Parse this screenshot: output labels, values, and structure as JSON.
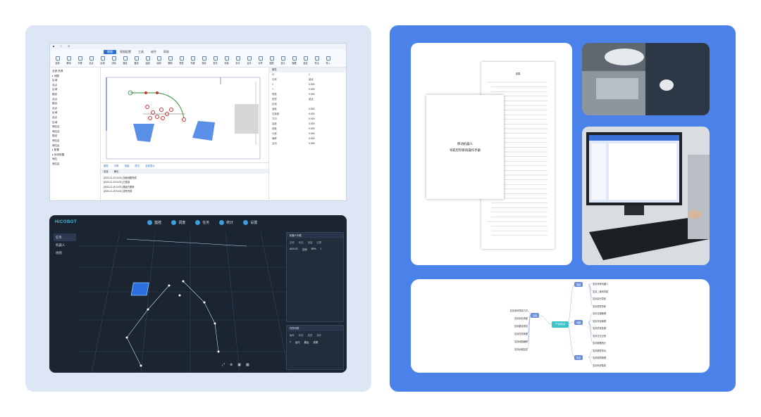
{
  "editor": {
    "menu": [
      "视图",
      "视图配置",
      "工具",
      "软件",
      "帮助"
    ],
    "ribbon": [
      "选择",
      "移动",
      "平移",
      "站点",
      "区域",
      "清除",
      "路径",
      "直线",
      "曲线",
      "绘制",
      "删除",
      "属性",
      "布置",
      "保存",
      "发布",
      "测量",
      "拆分",
      "合并",
      "对齐",
      "图层",
      "显示",
      "隐藏",
      "锁定",
      "导出",
      "导入"
    ],
    "tree": [
      "全部 资源",
      "▸ 地图",
      "区域",
      "站点",
      "区域",
      "路径",
      "站点",
      "路径",
      "站点",
      "区域",
      "站点",
      "区域",
      "储位区",
      "储位区",
      "路径",
      "储位区",
      "储位区",
      "▸ 配置",
      "▸ 系统配置",
      "储位",
      "储位区"
    ],
    "map_toolbar": [
      "缩放",
      "平移",
      "测量",
      "居中",
      "全部显示"
    ],
    "log_tabs": [
      "信息",
      "输出"
    ],
    "log_lines": [
      "[2024-11-19 14:51] 加载地图完成",
      "[2024-11-19 14:51] 已连接",
      "[2024-11-19 14:51] 路径已更新",
      "[2024-11-19 14:51] 发布完成"
    ],
    "props_header": "属性",
    "props": [
      {
        "k": "ID",
        "v": "1"
      },
      {
        "k": "名称",
        "v": "站点"
      },
      {
        "k": "X",
        "v": "0.000"
      },
      {
        "k": "Y",
        "v": "0.000"
      },
      {
        "k": "角度",
        "v": "0.000"
      },
      {
        "k": "类型",
        "v": "站点"
      },
      {
        "k": "区域",
        "v": ""
      },
      {
        "k": "速度",
        "v": "0.500"
      },
      {
        "k": "加速度",
        "v": "0.000"
      },
      {
        "k": "方向",
        "v": "0.000"
      },
      {
        "k": "高度",
        "v": "0.000"
      },
      {
        "k": "宽度",
        "v": "0.000"
      },
      {
        "k": "长度",
        "v": "0.000"
      },
      {
        "k": "偏移",
        "v": "0.000"
      },
      {
        "k": "启用",
        "v": "0.000"
      }
    ]
  },
  "robot_app": {
    "brand": "HICOBOT",
    "tabs": [
      "监控",
      "调度",
      "任务",
      "统计",
      "设置"
    ],
    "side": [
      "任务",
      "机器人",
      "地图"
    ],
    "panel1_title": "机器人列表",
    "panel1_cols": [
      "名称",
      "状态",
      "电量",
      "位置"
    ],
    "panel1_row": [
      "AGV-01",
      "空闲",
      "85%",
      "1"
    ],
    "panel2_title": "任务列表",
    "panel2_cols": [
      "编号",
      "状态",
      "类型",
      "操作"
    ],
    "panel2_row": [
      "1",
      "运行",
      "搬运",
      "查看"
    ],
    "robot_label": "AGV"
  },
  "document": {
    "front_title": "移动机器人",
    "front_subtitle": "导航控制系统操作手册",
    "toc_title": "目录"
  },
  "mindmap": {
    "center": "产品特点",
    "left_badge": "功能",
    "right_badges": [
      "调度",
      "地图",
      "安全"
    ],
    "left_items": [
      "支持多种导航方式",
      "支持多机调度",
      "支持路径规划",
      "支持任务管理",
      "支持地图编辑",
      "支持远程监控"
    ],
    "right_items": [
      "支持多种机器人",
      "支持二维码导航",
      "支持激光导航",
      "支持视觉导航",
      "支持交通管理",
      "支持充电管理",
      "支持异常处理",
      "支持日志记录",
      "支持数据统计",
      "支持报表导出",
      "支持权限管理",
      "支持系统集成"
    ]
  },
  "colors": {
    "left_bg": "#dce6f5",
    "right_bg": "#4a82ea",
    "accent": "#2b6fd6",
    "dark_bg": "#1b2431"
  }
}
